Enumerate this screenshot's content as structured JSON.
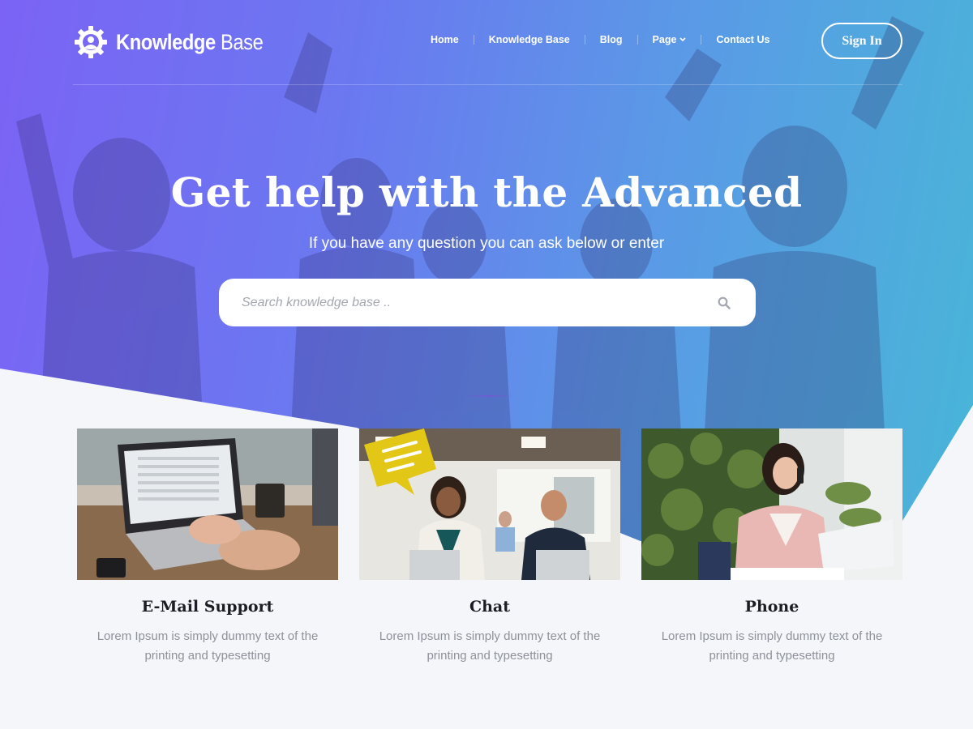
{
  "brand": {
    "name_bold": "Knowledge",
    "name_light": "Base"
  },
  "nav": {
    "items": [
      {
        "label": "Home"
      },
      {
        "label": "Knowledge Base"
      },
      {
        "label": "Blog"
      },
      {
        "label": "Page"
      },
      {
        "label": "Contact Us"
      }
    ],
    "signin_label": "Sign In"
  },
  "hero": {
    "title": "Get help with the Advanced",
    "subtitle": "If you have any question you can ask below or enter"
  },
  "search": {
    "placeholder": "Search knowledge base .."
  },
  "cards": [
    {
      "title": "E-Mail Support",
      "text": "Lorem Ipsum is simply dummy text of the printing and typesetting"
    },
    {
      "title": "Chat",
      "text": "Lorem Ipsum is simply dummy text of the printing and typesetting"
    },
    {
      "title": "Phone",
      "text": "Lorem Ipsum is simply dummy text of the printing and typesetting"
    }
  ],
  "icons": {
    "logo": "gear-person-icon",
    "search": "search-icon",
    "dropdown": "chevron-down-icon"
  },
  "colors": {
    "gradient_start": "#7b63f5",
    "gradient_end": "#48b6d8",
    "page_bg": "#f5f6fa",
    "card_title": "#1c1c24",
    "card_text": "#8d919a"
  }
}
